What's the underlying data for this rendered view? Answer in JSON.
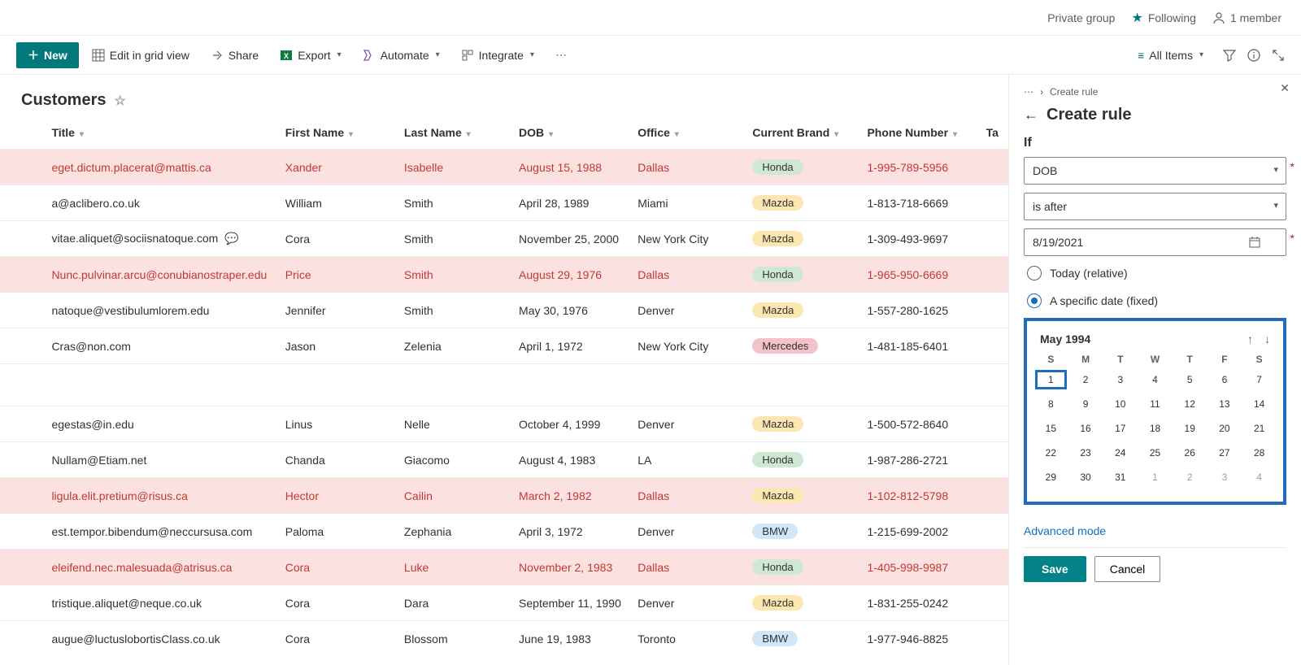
{
  "header": {
    "privacy": "Private group",
    "following": "Following",
    "members": "1 member"
  },
  "commandBar": {
    "newLabel": "New",
    "editGrid": "Edit in grid view",
    "share": "Share",
    "export": "Export",
    "automate": "Automate",
    "integrate": "Integrate",
    "allItems": "All Items"
  },
  "list": {
    "title": "Customers",
    "columns": {
      "title": "Title",
      "first": "First Name",
      "last": "Last Name",
      "dob": "DOB",
      "office": "Office",
      "brand": "Current Brand",
      "phone": "Phone Number",
      "tag": "Ta"
    },
    "rows": [
      {
        "hl": true,
        "title": "eget.dictum.placerat@mattis.ca",
        "first": "Xander",
        "last": "Isabelle",
        "dob": "August 15, 1988",
        "office": "Dallas",
        "brand": "Honda",
        "brandClass": "honda",
        "phone": "1-995-789-5956"
      },
      {
        "hl": false,
        "title": "a@aclibero.co.uk",
        "first": "William",
        "last": "Smith",
        "dob": "April 28, 1989",
        "office": "Miami",
        "brand": "Mazda",
        "brandClass": "mazda",
        "phone": "1-813-718-6669"
      },
      {
        "hl": false,
        "title": "vitae.aliquet@sociisnatoque.com",
        "comment": true,
        "first": "Cora",
        "last": "Smith",
        "dob": "November 25, 2000",
        "office": "New York City",
        "brand": "Mazda",
        "brandClass": "mazda",
        "phone": "1-309-493-9697"
      },
      {
        "hl": true,
        "title": "Nunc.pulvinar.arcu@conubianostraper.edu",
        "first": "Price",
        "last": "Smith",
        "dob": "August 29, 1976",
        "office": "Dallas",
        "brand": "Honda",
        "brandClass": "honda",
        "phone": "1-965-950-6669"
      },
      {
        "hl": false,
        "title": "natoque@vestibulumlorem.edu",
        "first": "Jennifer",
        "last": "Smith",
        "dob": "May 30, 1976",
        "office": "Denver",
        "brand": "Mazda",
        "brandClass": "mazda",
        "phone": "1-557-280-1625"
      },
      {
        "hl": false,
        "title": "Cras@non.com",
        "first": "Jason",
        "last": "Zelenia",
        "dob": "April 1, 1972",
        "office": "New York City",
        "brand": "Mercedes",
        "brandClass": "mercedes",
        "phone": "1-481-185-6401"
      },
      {
        "blank": true
      },
      {
        "hl": false,
        "title": "egestas@in.edu",
        "first": "Linus",
        "last": "Nelle",
        "dob": "October 4, 1999",
        "office": "Denver",
        "brand": "Mazda",
        "brandClass": "mazda",
        "phone": "1-500-572-8640"
      },
      {
        "hl": false,
        "title": "Nullam@Etiam.net",
        "first": "Chanda",
        "last": "Giacomo",
        "dob": "August 4, 1983",
        "office": "LA",
        "brand": "Honda",
        "brandClass": "honda",
        "phone": "1-987-286-2721"
      },
      {
        "hl": true,
        "title": "ligula.elit.pretium@risus.ca",
        "first": "Hector",
        "last": "Cailin",
        "dob": "March 2, 1982",
        "office": "Dallas",
        "brand": "Mazda",
        "brandClass": "mazda",
        "phone": "1-102-812-5798"
      },
      {
        "hl": false,
        "title": "est.tempor.bibendum@neccursusa.com",
        "first": "Paloma",
        "last": "Zephania",
        "dob": "April 3, 1972",
        "office": "Denver",
        "brand": "BMW",
        "brandClass": "bmw",
        "phone": "1-215-699-2002"
      },
      {
        "hl": true,
        "title": "eleifend.nec.malesuada@atrisus.ca",
        "first": "Cora",
        "last": "Luke",
        "dob": "November 2, 1983",
        "office": "Dallas",
        "brand": "Honda",
        "brandClass": "honda",
        "phone": "1-405-998-9987"
      },
      {
        "hl": false,
        "title": "tristique.aliquet@neque.co.uk",
        "first": "Cora",
        "last": "Dara",
        "dob": "September 11, 1990",
        "office": "Denver",
        "brand": "Mazda",
        "brandClass": "mazda",
        "phone": "1-831-255-0242"
      },
      {
        "hl": false,
        "title": "augue@luctuslobortisClass.co.uk",
        "first": "Cora",
        "last": "Blossom",
        "dob": "June 19, 1983",
        "office": "Toronto",
        "brand": "BMW",
        "brandClass": "bmw",
        "phone": "1-977-946-8825"
      }
    ]
  },
  "rule": {
    "breadcrumb": "Create rule",
    "heading": "Create rule",
    "if": "If",
    "column": "DOB",
    "operator": "is after",
    "dateValue": "8/19/2021",
    "optRelative": "Today (relative)",
    "optFixed": "A specific date (fixed)",
    "calendar": {
      "monthYear": "May 1994",
      "weekdays": [
        "S",
        "M",
        "T",
        "W",
        "T",
        "F",
        "S"
      ],
      "weeks": [
        [
          {
            "n": 1,
            "sel": true
          },
          {
            "n": 2
          },
          {
            "n": 3
          },
          {
            "n": 4
          },
          {
            "n": 5
          },
          {
            "n": 6
          },
          {
            "n": 7
          }
        ],
        [
          {
            "n": 8
          },
          {
            "n": 9
          },
          {
            "n": 10
          },
          {
            "n": 11
          },
          {
            "n": 12
          },
          {
            "n": 13
          },
          {
            "n": 14
          }
        ],
        [
          {
            "n": 15
          },
          {
            "n": 16
          },
          {
            "n": 17
          },
          {
            "n": 18
          },
          {
            "n": 19
          },
          {
            "n": 20
          },
          {
            "n": 21
          }
        ],
        [
          {
            "n": 22
          },
          {
            "n": 23
          },
          {
            "n": 24
          },
          {
            "n": 25
          },
          {
            "n": 26
          },
          {
            "n": 27
          },
          {
            "n": 28
          }
        ],
        [
          {
            "n": 29
          },
          {
            "n": 30
          },
          {
            "n": 31
          },
          {
            "n": 1,
            "other": true
          },
          {
            "n": 2,
            "other": true
          },
          {
            "n": 3,
            "other": true
          },
          {
            "n": 4,
            "other": true
          }
        ]
      ]
    },
    "advanced": "Advanced mode",
    "save": "Save",
    "cancel": "Cancel"
  }
}
